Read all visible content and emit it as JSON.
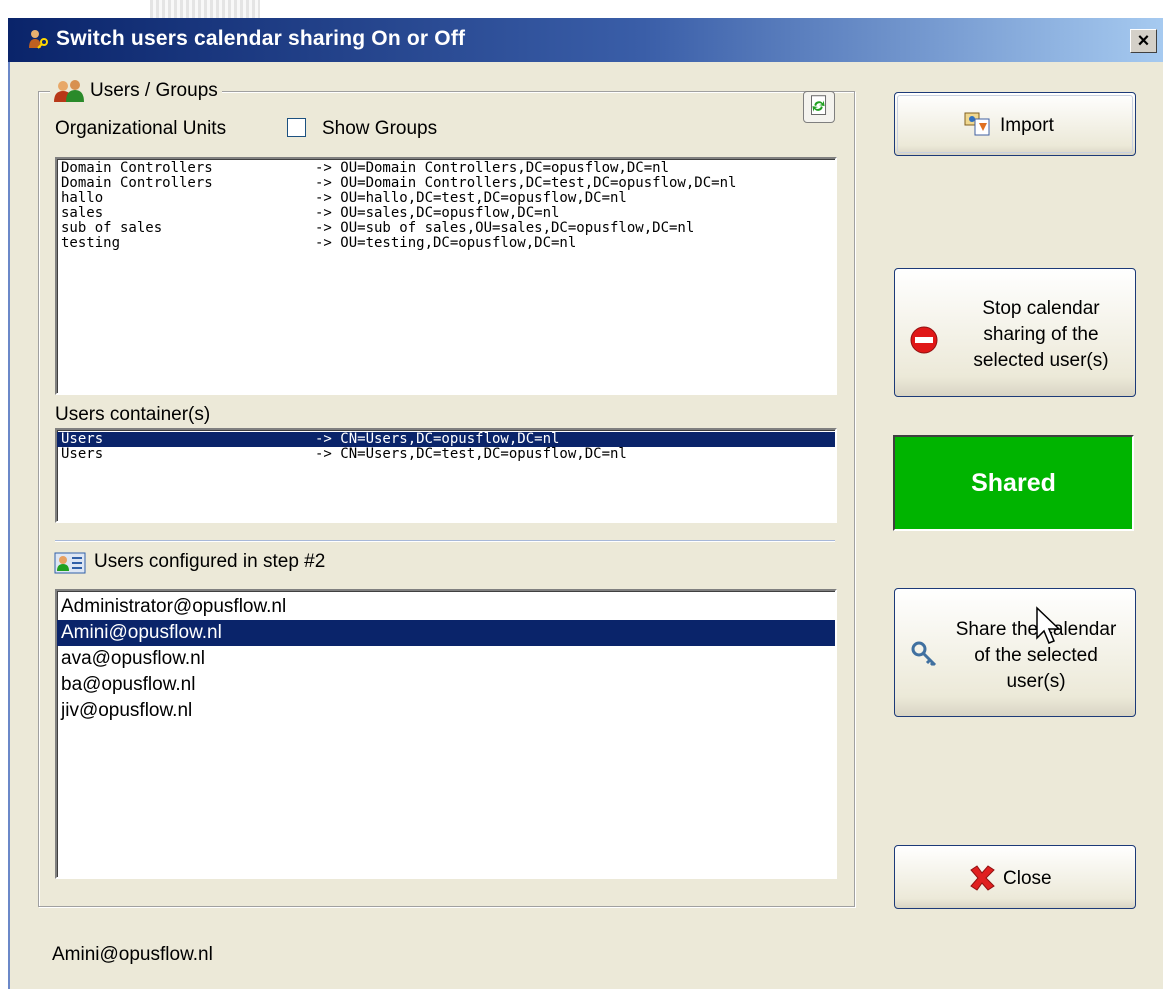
{
  "window": {
    "title": "Switch users calendar sharing On or Off",
    "close_glyph": "×"
  },
  "group": {
    "legend": "Users / Groups"
  },
  "ou": {
    "label": "Organizational Units",
    "show_groups_label": "Show Groups",
    "items": [
      {
        "name": "Domain Controllers",
        "path": "-> OU=Domain Controllers,DC=opusflow,DC=nl"
      },
      {
        "name": "Domain Controllers",
        "path": "-> OU=Domain Controllers,DC=test,DC=opusflow,DC=nl"
      },
      {
        "name": "hallo",
        "path": "-> OU=hallo,DC=test,DC=opusflow,DC=nl"
      },
      {
        "name": "sales",
        "path": "-> OU=sales,DC=opusflow,DC=nl"
      },
      {
        "name": "sub of sales",
        "path": "-> OU=sub of sales,OU=sales,DC=opusflow,DC=nl"
      },
      {
        "name": "testing",
        "path": "-> OU=testing,DC=opusflow,DC=nl"
      }
    ]
  },
  "containers": {
    "label": "Users container(s)",
    "items": [
      {
        "name": "Users",
        "path": "-> CN=Users,DC=opusflow,DC=nl",
        "selected": true
      },
      {
        "name": "Users",
        "path": "-> CN=Users,DC=test,DC=opusflow,DC=nl",
        "selected": false
      }
    ]
  },
  "configured": {
    "label": "Users configured in step #2",
    "items": [
      {
        "email": "Administrator@opusflow.nl",
        "selected": false
      },
      {
        "email": "Amini@opusflow.nl",
        "selected": true
      },
      {
        "email": "ava@opusflow.nl",
        "selected": false
      },
      {
        "email": "ba@opusflow.nl",
        "selected": false
      },
      {
        "email": "jiv@opusflow.nl",
        "selected": false
      }
    ]
  },
  "buttons": {
    "import": "Import",
    "stop": [
      "Stop calendar",
      "sharing of the",
      "selected user(s)"
    ],
    "share": [
      "Share the calendar",
      "of the selected",
      "user(s)"
    ],
    "close": "Close"
  },
  "status": {
    "shared": "Shared",
    "shared_color": "#00b400",
    "selected_user": "Amini@opusflow.nl"
  },
  "icons": [
    "app-users-key-icon",
    "users-group-icon",
    "refresh-icon",
    "user-card-icon",
    "import-icon",
    "stop-icon",
    "key-icon",
    "close-x-icon",
    "mouse-cursor-icon"
  ]
}
